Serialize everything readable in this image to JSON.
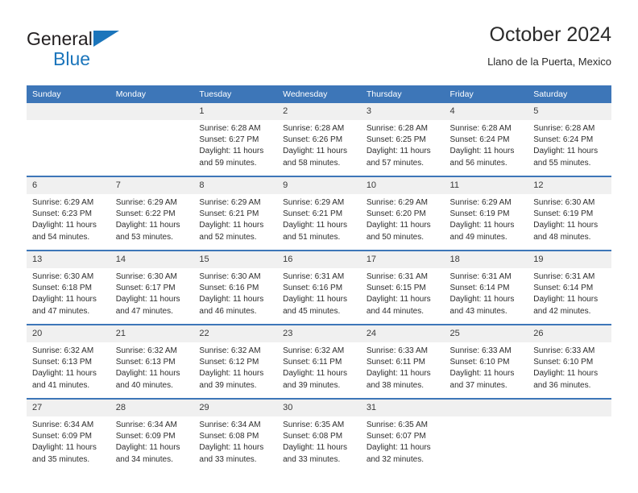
{
  "logo": {
    "line1": "General",
    "line2": "Blue",
    "triangle_icon": "blue-triangle-icon",
    "brand_color": "#1b75bb"
  },
  "header": {
    "title": "October 2024",
    "location": "Llano de la Puerta, Mexico"
  },
  "theme": {
    "header_blue": "#3d76b8",
    "daynum_band": "#f0f0f0",
    "text": "#2d2d2d"
  },
  "calendar": {
    "weekday_headers": [
      "Sunday",
      "Monday",
      "Tuesday",
      "Wednesday",
      "Thursday",
      "Friday",
      "Saturday"
    ],
    "weeks": [
      [
        {
          "day": "",
          "empty": true,
          "sunrise": "",
          "sunset": "",
          "daylight1": "",
          "daylight2": ""
        },
        {
          "day": "",
          "empty": true,
          "sunrise": "",
          "sunset": "",
          "daylight1": "",
          "daylight2": ""
        },
        {
          "day": "1",
          "empty": false,
          "sunrise": "Sunrise: 6:28 AM",
          "sunset": "Sunset: 6:27 PM",
          "daylight1": "Daylight: 11 hours",
          "daylight2": "and 59 minutes."
        },
        {
          "day": "2",
          "empty": false,
          "sunrise": "Sunrise: 6:28 AM",
          "sunset": "Sunset: 6:26 PM",
          "daylight1": "Daylight: 11 hours",
          "daylight2": "and 58 minutes."
        },
        {
          "day": "3",
          "empty": false,
          "sunrise": "Sunrise: 6:28 AM",
          "sunset": "Sunset: 6:25 PM",
          "daylight1": "Daylight: 11 hours",
          "daylight2": "and 57 minutes."
        },
        {
          "day": "4",
          "empty": false,
          "sunrise": "Sunrise: 6:28 AM",
          "sunset": "Sunset: 6:24 PM",
          "daylight1": "Daylight: 11 hours",
          "daylight2": "and 56 minutes."
        },
        {
          "day": "5",
          "empty": false,
          "sunrise": "Sunrise: 6:28 AM",
          "sunset": "Sunset: 6:24 PM",
          "daylight1": "Daylight: 11 hours",
          "daylight2": "and 55 minutes."
        }
      ],
      [
        {
          "day": "6",
          "empty": false,
          "sunrise": "Sunrise: 6:29 AM",
          "sunset": "Sunset: 6:23 PM",
          "daylight1": "Daylight: 11 hours",
          "daylight2": "and 54 minutes."
        },
        {
          "day": "7",
          "empty": false,
          "sunrise": "Sunrise: 6:29 AM",
          "sunset": "Sunset: 6:22 PM",
          "daylight1": "Daylight: 11 hours",
          "daylight2": "and 53 minutes."
        },
        {
          "day": "8",
          "empty": false,
          "sunrise": "Sunrise: 6:29 AM",
          "sunset": "Sunset: 6:21 PM",
          "daylight1": "Daylight: 11 hours",
          "daylight2": "and 52 minutes."
        },
        {
          "day": "9",
          "empty": false,
          "sunrise": "Sunrise: 6:29 AM",
          "sunset": "Sunset: 6:21 PM",
          "daylight1": "Daylight: 11 hours",
          "daylight2": "and 51 minutes."
        },
        {
          "day": "10",
          "empty": false,
          "sunrise": "Sunrise: 6:29 AM",
          "sunset": "Sunset: 6:20 PM",
          "daylight1": "Daylight: 11 hours",
          "daylight2": "and 50 minutes."
        },
        {
          "day": "11",
          "empty": false,
          "sunrise": "Sunrise: 6:29 AM",
          "sunset": "Sunset: 6:19 PM",
          "daylight1": "Daylight: 11 hours",
          "daylight2": "and 49 minutes."
        },
        {
          "day": "12",
          "empty": false,
          "sunrise": "Sunrise: 6:30 AM",
          "sunset": "Sunset: 6:19 PM",
          "daylight1": "Daylight: 11 hours",
          "daylight2": "and 48 minutes."
        }
      ],
      [
        {
          "day": "13",
          "empty": false,
          "sunrise": "Sunrise: 6:30 AM",
          "sunset": "Sunset: 6:18 PM",
          "daylight1": "Daylight: 11 hours",
          "daylight2": "and 47 minutes."
        },
        {
          "day": "14",
          "empty": false,
          "sunrise": "Sunrise: 6:30 AM",
          "sunset": "Sunset: 6:17 PM",
          "daylight1": "Daylight: 11 hours",
          "daylight2": "and 47 minutes."
        },
        {
          "day": "15",
          "empty": false,
          "sunrise": "Sunrise: 6:30 AM",
          "sunset": "Sunset: 6:16 PM",
          "daylight1": "Daylight: 11 hours",
          "daylight2": "and 46 minutes."
        },
        {
          "day": "16",
          "empty": false,
          "sunrise": "Sunrise: 6:31 AM",
          "sunset": "Sunset: 6:16 PM",
          "daylight1": "Daylight: 11 hours",
          "daylight2": "and 45 minutes."
        },
        {
          "day": "17",
          "empty": false,
          "sunrise": "Sunrise: 6:31 AM",
          "sunset": "Sunset: 6:15 PM",
          "daylight1": "Daylight: 11 hours",
          "daylight2": "and 44 minutes."
        },
        {
          "day": "18",
          "empty": false,
          "sunrise": "Sunrise: 6:31 AM",
          "sunset": "Sunset: 6:14 PM",
          "daylight1": "Daylight: 11 hours",
          "daylight2": "and 43 minutes."
        },
        {
          "day": "19",
          "empty": false,
          "sunrise": "Sunrise: 6:31 AM",
          "sunset": "Sunset: 6:14 PM",
          "daylight1": "Daylight: 11 hours",
          "daylight2": "and 42 minutes."
        }
      ],
      [
        {
          "day": "20",
          "empty": false,
          "sunrise": "Sunrise: 6:32 AM",
          "sunset": "Sunset: 6:13 PM",
          "daylight1": "Daylight: 11 hours",
          "daylight2": "and 41 minutes."
        },
        {
          "day": "21",
          "empty": false,
          "sunrise": "Sunrise: 6:32 AM",
          "sunset": "Sunset: 6:13 PM",
          "daylight1": "Daylight: 11 hours",
          "daylight2": "and 40 minutes."
        },
        {
          "day": "22",
          "empty": false,
          "sunrise": "Sunrise: 6:32 AM",
          "sunset": "Sunset: 6:12 PM",
          "daylight1": "Daylight: 11 hours",
          "daylight2": "and 39 minutes."
        },
        {
          "day": "23",
          "empty": false,
          "sunrise": "Sunrise: 6:32 AM",
          "sunset": "Sunset: 6:11 PM",
          "daylight1": "Daylight: 11 hours",
          "daylight2": "and 39 minutes."
        },
        {
          "day": "24",
          "empty": false,
          "sunrise": "Sunrise: 6:33 AM",
          "sunset": "Sunset: 6:11 PM",
          "daylight1": "Daylight: 11 hours",
          "daylight2": "and 38 minutes."
        },
        {
          "day": "25",
          "empty": false,
          "sunrise": "Sunrise: 6:33 AM",
          "sunset": "Sunset: 6:10 PM",
          "daylight1": "Daylight: 11 hours",
          "daylight2": "and 37 minutes."
        },
        {
          "day": "26",
          "empty": false,
          "sunrise": "Sunrise: 6:33 AM",
          "sunset": "Sunset: 6:10 PM",
          "daylight1": "Daylight: 11 hours",
          "daylight2": "and 36 minutes."
        }
      ],
      [
        {
          "day": "27",
          "empty": false,
          "sunrise": "Sunrise: 6:34 AM",
          "sunset": "Sunset: 6:09 PM",
          "daylight1": "Daylight: 11 hours",
          "daylight2": "and 35 minutes."
        },
        {
          "day": "28",
          "empty": false,
          "sunrise": "Sunrise: 6:34 AM",
          "sunset": "Sunset: 6:09 PM",
          "daylight1": "Daylight: 11 hours",
          "daylight2": "and 34 minutes."
        },
        {
          "day": "29",
          "empty": false,
          "sunrise": "Sunrise: 6:34 AM",
          "sunset": "Sunset: 6:08 PM",
          "daylight1": "Daylight: 11 hours",
          "daylight2": "and 33 minutes."
        },
        {
          "day": "30",
          "empty": false,
          "sunrise": "Sunrise: 6:35 AM",
          "sunset": "Sunset: 6:08 PM",
          "daylight1": "Daylight: 11 hours",
          "daylight2": "and 33 minutes."
        },
        {
          "day": "31",
          "empty": false,
          "sunrise": "Sunrise: 6:35 AM",
          "sunset": "Sunset: 6:07 PM",
          "daylight1": "Daylight: 11 hours",
          "daylight2": "and 32 minutes."
        },
        {
          "day": "",
          "empty": true,
          "sunrise": "",
          "sunset": "",
          "daylight1": "",
          "daylight2": ""
        },
        {
          "day": "",
          "empty": true,
          "sunrise": "",
          "sunset": "",
          "daylight1": "",
          "daylight2": ""
        }
      ]
    ]
  }
}
